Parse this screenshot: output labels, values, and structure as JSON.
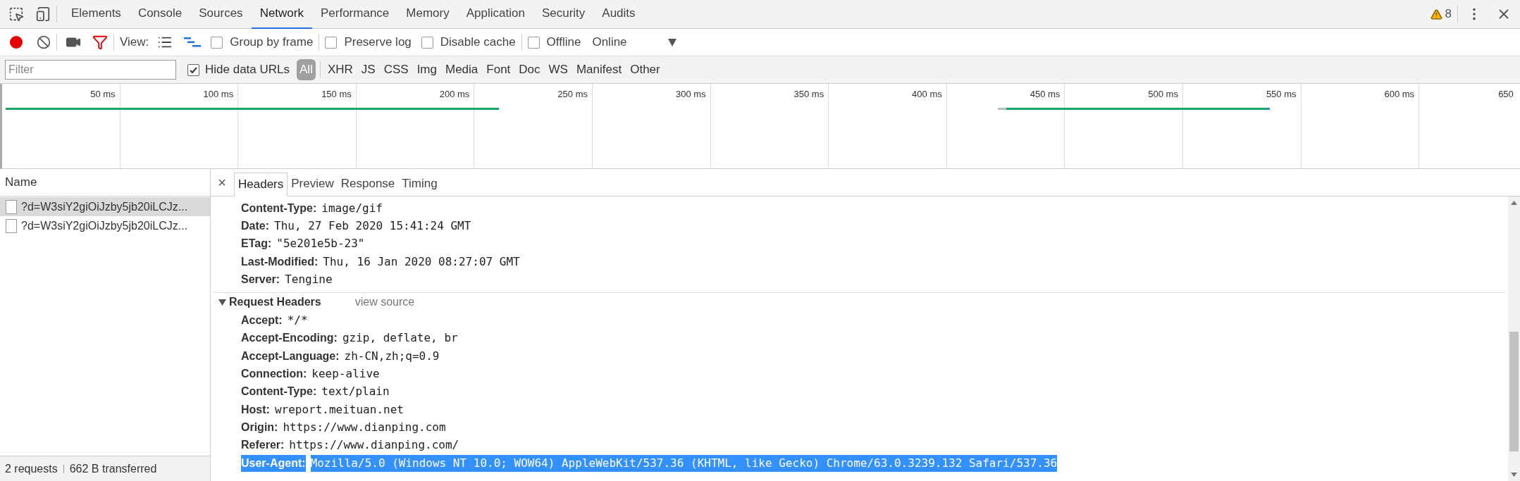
{
  "main_tabs": [
    {
      "label": "Elements",
      "selected": false
    },
    {
      "label": "Console",
      "selected": false
    },
    {
      "label": "Sources",
      "selected": false
    },
    {
      "label": "Network",
      "selected": true
    },
    {
      "label": "Performance",
      "selected": false
    },
    {
      "label": "Memory",
      "selected": false
    },
    {
      "label": "Application",
      "selected": false
    },
    {
      "label": "Security",
      "selected": false
    },
    {
      "label": "Audits",
      "selected": false
    }
  ],
  "warnings": "8",
  "toolbar": {
    "recording": true,
    "view_label": "View:",
    "options": [
      {
        "label": "Group by frame",
        "checked": false
      },
      {
        "label": "Preserve log",
        "checked": false
      },
      {
        "label": "Disable cache",
        "checked": false
      },
      {
        "label": "Offline",
        "checked": false
      }
    ],
    "throttling": "Online"
  },
  "filter": {
    "placeholder": "Filter",
    "hide_data_urls": {
      "label": "Hide data URLs",
      "checked": true
    },
    "types": [
      {
        "label": "All",
        "selected": true
      },
      {
        "label": "XHR",
        "selected": false
      },
      {
        "label": "JS",
        "selected": false
      },
      {
        "label": "CSS",
        "selected": false
      },
      {
        "label": "Img",
        "selected": false
      },
      {
        "label": "Media",
        "selected": false
      },
      {
        "label": "Font",
        "selected": false
      },
      {
        "label": "Doc",
        "selected": false
      },
      {
        "label": "WS",
        "selected": false
      },
      {
        "label": "Manifest",
        "selected": false
      },
      {
        "label": "Other",
        "selected": false
      }
    ]
  },
  "timeline": {
    "ticks": [
      "50 ms",
      "100 ms",
      "150 ms",
      "200 ms",
      "250 ms",
      "300 ms",
      "350 ms",
      "400 ms",
      "450 ms",
      "500 ms",
      "550 ms",
      "600 ms",
      "650"
    ]
  },
  "requests": {
    "column": "Name",
    "rows": [
      {
        "name": "?d=W3siY2giOiJzby5jb20iLCJz...",
        "selected": true
      },
      {
        "name": "?d=W3siY2giOiJzby5jb20iLCJz...",
        "selected": false
      }
    ]
  },
  "status": {
    "requests": "2 requests",
    "transferred": "662 B transferred"
  },
  "detail": {
    "close": "×",
    "tabs": [
      {
        "label": "Headers",
        "selected": true
      },
      {
        "label": "Preview",
        "selected": false
      },
      {
        "label": "Response",
        "selected": false
      },
      {
        "label": "Timing",
        "selected": false
      }
    ],
    "response_headers": [
      {
        "name": "Content-Type:",
        "value": "image/gif"
      },
      {
        "name": "Date:",
        "value": "Thu, 27 Feb 2020 15:41:24 GMT"
      },
      {
        "name": "ETag:",
        "value": "\"5e201e5b-23\""
      },
      {
        "name": "Last-Modified:",
        "value": "Thu, 16 Jan 2020 08:27:07 GMT"
      },
      {
        "name": "Server:",
        "value": "Tengine"
      }
    ],
    "request_headers": {
      "title": "Request Headers",
      "expanded": true,
      "view_source": "view source",
      "headers": [
        {
          "name": "Accept:",
          "value": "*/*",
          "selected": false
        },
        {
          "name": "Accept-Encoding:",
          "value": "gzip, deflate, br",
          "selected": false
        },
        {
          "name": "Accept-Language:",
          "value": "zh-CN,zh;q=0.9",
          "selected": false
        },
        {
          "name": "Connection:",
          "value": "keep-alive",
          "selected": false
        },
        {
          "name": "Content-Type:",
          "value": "text/plain",
          "selected": false
        },
        {
          "name": "Host:",
          "value": "wreport.meituan.net",
          "selected": false
        },
        {
          "name": "Origin:",
          "value": "https://www.dianping.com",
          "selected": false
        },
        {
          "name": "Referer:",
          "value": "https://www.dianping.com/",
          "selected": false
        },
        {
          "name": "User-Agent:",
          "value": "Mozilla/5.0 (Windows NT 10.0; WOW64) AppleWebKit/537.36 (KHTML, like Gecko) Chrome/63.0.3239.132 Safari/537.36",
          "selected": true
        }
      ]
    }
  }
}
